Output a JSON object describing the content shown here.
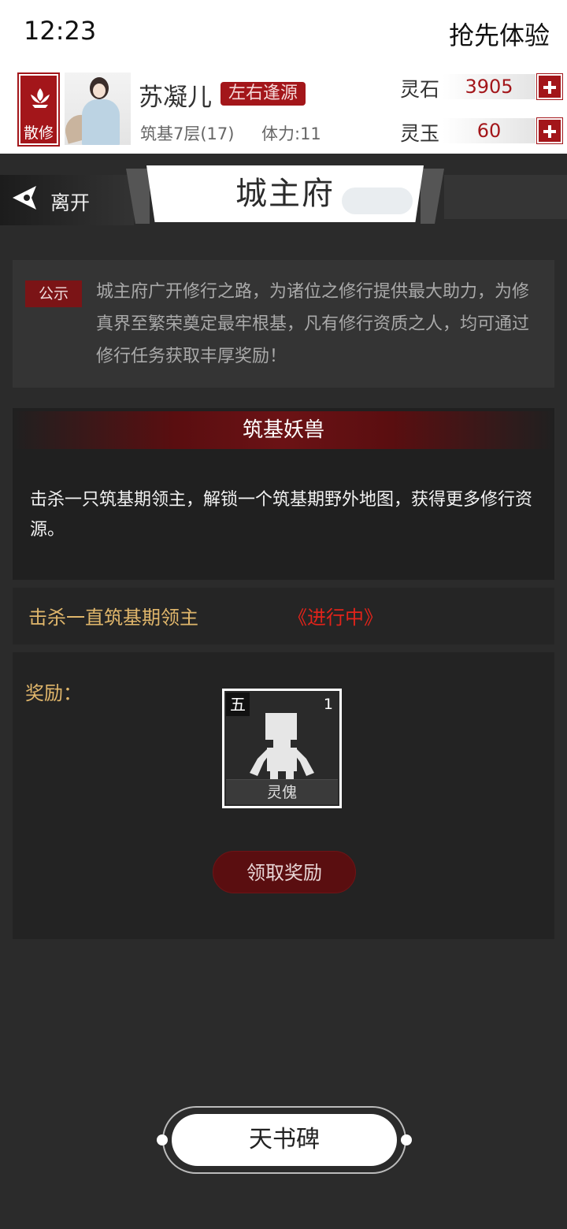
{
  "status_bar": {
    "time": "12:23",
    "early_access": "抢先体验"
  },
  "player": {
    "sect": "散修",
    "name": "苏凝儿",
    "title_tag": "左右逢源",
    "level": "筑基7层(17)",
    "stamina": "体力:11"
  },
  "currencies": [
    {
      "label": "灵石",
      "value": "3905"
    },
    {
      "label": "灵玉",
      "value": "60"
    }
  ],
  "nav": {
    "leave_label": "离开",
    "page_title": "城主府"
  },
  "notice": {
    "tag": "公示",
    "text": "城主府广开修行之路，为诸位之修行提供最大助力，为修真界至繁荣奠定最牢根基，凡有修行资质之人，均可通过修行任务获取丰厚奖励！"
  },
  "quest": {
    "title": "筑基妖兽",
    "description": "击杀一只筑基期领主，解锁一个筑基期野外地图，获得更多修行资源。",
    "objective": "击杀一直筑基期领主",
    "status": "《进行中》"
  },
  "rewards": {
    "label": "奖励：",
    "items": [
      {
        "grade": "五",
        "count": "1",
        "name": "灵傀",
        "icon": "puppet-icon"
      }
    ],
    "claim_label": "领取奖励"
  },
  "bottom": {
    "button_label": "天书碑"
  },
  "colors": {
    "accent_red": "#a3161a",
    "gold_text": "#e0b66b",
    "status_red": "#e2231a"
  }
}
